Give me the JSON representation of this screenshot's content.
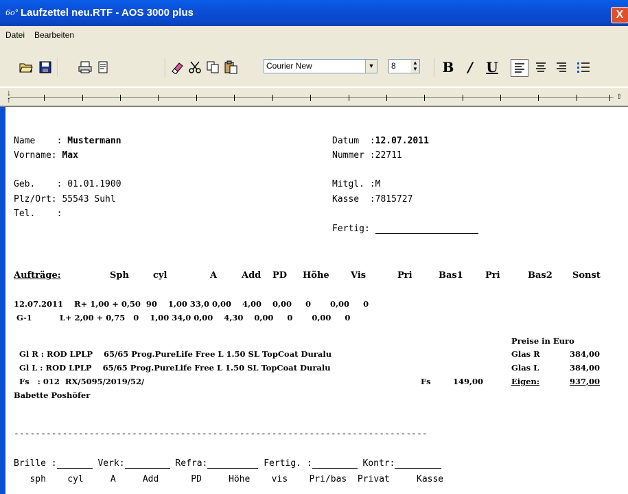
{
  "window": {
    "title": "Laufzettel neu.RTF - AOS 3000 plus",
    "close": "X"
  },
  "menu": {
    "datei": "Datei",
    "bearbeiten": "Bearbeiten"
  },
  "toolbar": {
    "font": "Courier New",
    "size": "8",
    "bold": "B",
    "italic": "/",
    "underline": "U"
  },
  "doc": {
    "name_label": "Name    : ",
    "name": "Mustermann",
    "vorname_label": "Vorname: ",
    "vorname": "Max",
    "geb": "Geb.    : 01.01.1900",
    "plz": "Plz/Ort: 55543 Suhl",
    "tel": "Tel.    :",
    "datum_label": "Datum  :",
    "datum": "12.07.2011",
    "nummer": "Nummer :22711",
    "mitgl": "Mitgl. :M",
    "kasse": "Kasse  :7815727",
    "fertig": "Fertig:",
    "headers": {
      "auftraege": "Aufträge:",
      "sph": "Sph",
      "cyl": "cyl",
      "a": "A",
      "add": "Add",
      "pd": "PD",
      "hoehe": "Höhe",
      "vis": "Vis",
      "pri": "Pri",
      "bas1": "Bas1",
      "pri2": "Pri",
      "bas2": "Bas2",
      "sonst": "Sonst"
    },
    "row1": "12.07.2011    R+ 1,00 + 0,50  90    1,00 33,0 0,00    4,00    0,00     0       0,00     0",
    "row2": " G-1          L+ 2,00 + 0,75   0    1,00 34,0 0,00    4,30    0,00     0       0,00     0",
    "preise": "Preise in Euro",
    "gl_r": "  Gl R : ROD LPLP    65/65 Prog.PureLife Free L 1.50 SL TopCoat Duralu",
    "gl_l": "  Gl L : ROD LPLP    65/65 Prog.PureLife Free L 1.50 SL TopCoat Duralu",
    "fs": "  Fs   : 012  RX/5095/2019/52/",
    "fs_price_label": "Fs",
    "fs_price": "149,00",
    "glas_r": "Glas R",
    "glas_r_price": "384,00",
    "glas_l": "Glas L",
    "glas_l_price": "384,00",
    "eigen": "Eigen:",
    "eigen_price": "937,00",
    "babette": "Babette Poshöfer",
    "dashes": "-----------------------------------------------------------------------------",
    "brille": "Brille :",
    "verk": "Verk:",
    "refra": "Refra:",
    "fertig2": "Fertig. :",
    "kontr": "Kontr:",
    "footer": "   sph    cyl     A     Add      PD     Höhe    vis    Pri/bas  Privat     Kasse"
  }
}
